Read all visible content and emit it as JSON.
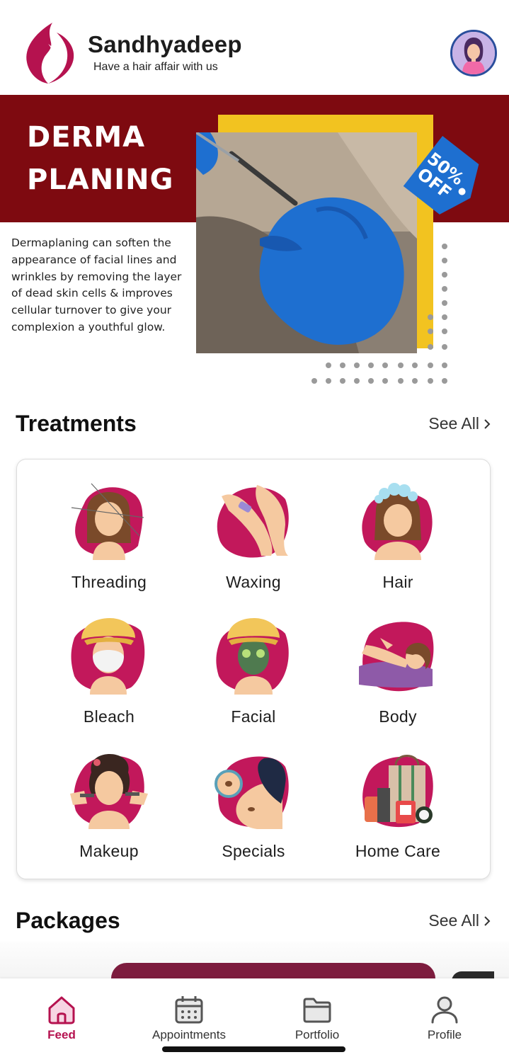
{
  "header": {
    "brand": "Sandhyadeep",
    "tagline": "Have a hair affair with us",
    "logo_icon": "woman-silhouette-logo-icon",
    "avatar_icon": "user-avatar-icon"
  },
  "banner": {
    "title_line1": "DERMA",
    "title_line2": "PLANING",
    "description": "Dermaplaning can soften the appearance of facial lines and wrinkles by removing the layer of dead skin cells & improves cellular turnover to give your complexion a youthful glow.",
    "tag_line1": "50%",
    "tag_line2": "OFF",
    "colors": {
      "red": "#7e0a10",
      "yellow": "#f2c320",
      "blue": "#1e6fd0"
    }
  },
  "treatments": {
    "title": "Treatments",
    "see_all": "See All",
    "items": [
      {
        "label": "Threading",
        "icon": "threading-icon"
      },
      {
        "label": "Waxing",
        "icon": "waxing-icon"
      },
      {
        "label": "Hair",
        "icon": "hair-wash-icon"
      },
      {
        "label": "Bleach",
        "icon": "bleach-icon"
      },
      {
        "label": "Facial",
        "icon": "facial-mask-icon"
      },
      {
        "label": "Body",
        "icon": "body-massage-icon"
      },
      {
        "label": "Makeup",
        "icon": "makeup-icon"
      },
      {
        "label": "Specials",
        "icon": "specials-icon"
      },
      {
        "label": "Home Care",
        "icon": "home-care-products-icon"
      }
    ]
  },
  "packages": {
    "title": "Packages",
    "see_all": "See All"
  },
  "nav": {
    "items": [
      {
        "label": "Feed",
        "icon": "home-icon",
        "active": true
      },
      {
        "label": "Appointments",
        "icon": "calendar-icon",
        "active": false
      },
      {
        "label": "Portfolio",
        "icon": "folder-icon",
        "active": false
      },
      {
        "label": "Profile",
        "icon": "user-icon",
        "active": false
      }
    ]
  },
  "colors": {
    "accent": "#b5124f",
    "blob": "#c2185b",
    "skin": "#f5c9a0"
  }
}
